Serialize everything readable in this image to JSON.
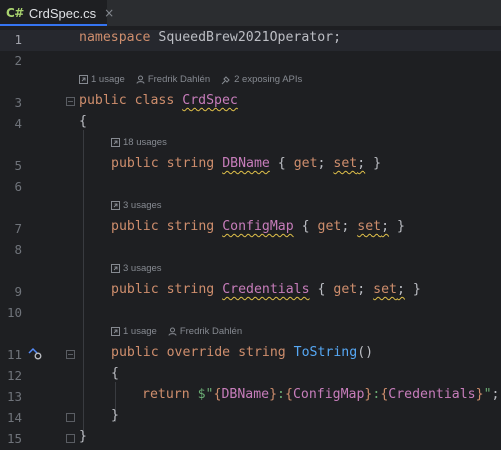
{
  "tab": {
    "icon": "C#",
    "label": "CrdSpec.cs",
    "close": "×"
  },
  "line_numbers": [
    "1",
    "2",
    "3",
    "4",
    "5",
    "6",
    "7",
    "8",
    "9",
    "10",
    "11",
    "12",
    "13",
    "14",
    "15"
  ],
  "hints": {
    "class": {
      "usages": "1 usage",
      "author": "Fredrik Dahlén",
      "apis": "2 exposing APIs"
    },
    "dbname": {
      "usages": "18 usages"
    },
    "configmap": {
      "usages": "3 usages"
    },
    "credentials": {
      "usages": "3 usages"
    },
    "tostring": {
      "usages": "1 usage",
      "author": "Fredrik Dahlén"
    }
  },
  "code": {
    "l1": {
      "kw": "namespace",
      "ns": "SqueedBrew2021Operator",
      "end": ";"
    },
    "l3": {
      "kw1": "public",
      "kw2": "class",
      "name": "CrdSpec"
    },
    "l4": "{",
    "l5": {
      "kw1": "public",
      "kw2": "string",
      "name": "DBName",
      "o": "{",
      "get": "get",
      "s1": ";",
      "set": "set",
      "s2": ";",
      "c": "}"
    },
    "l7": {
      "kw1": "public",
      "kw2": "string",
      "name": "ConfigMap",
      "o": "{",
      "get": "get",
      "s1": ";",
      "set": "set",
      "s2": ";",
      "c": "}"
    },
    "l9": {
      "kw1": "public",
      "kw2": "string",
      "name": "Credentials",
      "o": "{",
      "get": "get",
      "s1": ";",
      "set": "set",
      "s2": ";",
      "c": "}"
    },
    "l11": {
      "kw1": "public",
      "kw2": "override",
      "kw3": "string",
      "name": "ToString",
      "paren": "()"
    },
    "l12": "{",
    "l13": {
      "kw": "return",
      "s0": "$\"",
      "b1": "{",
      "v1": "DBName",
      "b1c": "}",
      "sep1": ":",
      "b2": "{",
      "v2": "ConfigMap",
      "b2c": "}",
      "sep2": ":",
      "b3": "{",
      "v3": "Credentials",
      "b3c": "}",
      "s_end": "\"",
      "end": ";"
    },
    "l14": "}",
    "l15": "}"
  }
}
